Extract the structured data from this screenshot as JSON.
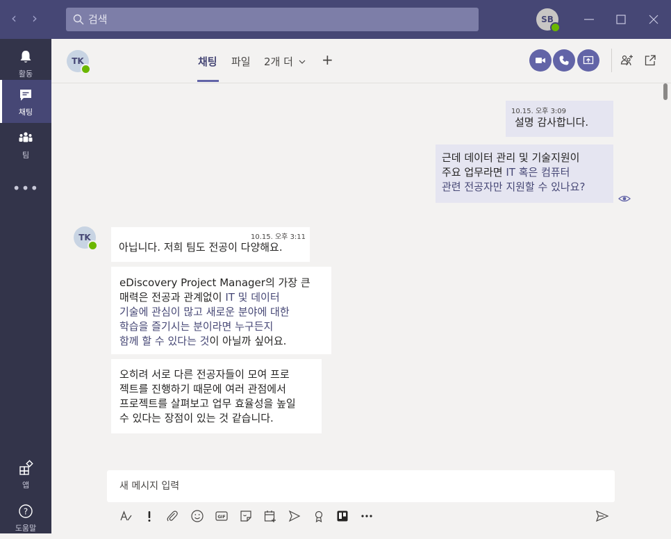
{
  "titlebar": {
    "search_placeholder": "검색",
    "user_initials": "SB"
  },
  "rail": {
    "items": [
      {
        "label": "활동",
        "icon": "bell-icon"
      },
      {
        "label": "채팅",
        "icon": "chat-icon"
      },
      {
        "label": "팀",
        "icon": "teams-icon"
      },
      {
        "label": "앱",
        "icon": "apps-icon"
      },
      {
        "label": "도움말",
        "icon": "help-icon"
      }
    ],
    "more": "•••"
  },
  "header": {
    "contact_initials": "TK",
    "tabs": [
      {
        "label": "채팅"
      },
      {
        "label": "파일"
      },
      {
        "label": "2개 더"
      }
    ],
    "add_tab": "+"
  },
  "messages": {
    "mine": [
      {
        "time": "10.15. 오후 3:09",
        "text": "설명 감사합니다."
      },
      {
        "lines": [
          {
            "plain": "근데 데이터 관리 및 기술지원이"
          },
          {
            "plain": "주요 업무라면 ",
            "hl": "IT 혹은 컴퓨터"
          },
          {
            "hl": "관련 전공자만 지원할 수 있나요?"
          }
        ]
      }
    ],
    "other": [
      {
        "initials": "TK",
        "time": "10.15. 오후 3:11",
        "text": "아닙니다. 저희 팀도 전공이 다양해요."
      },
      {
        "lines": [
          {
            "plain": "eDiscovery Project Manager의 가장 큰"
          },
          {
            "plain": "매력은 전공과 관계없이 ",
            "hl": "IT 및 데이터"
          },
          {
            "hl": "기술에 관심이 많고 새로운 분야에 대한"
          },
          {
            "hl": "학습을 즐기시는 분이라면 누구든지"
          },
          {
            "hl": "함께 할 수 있다는 것",
            "plain_after": "이 아닐까 싶어요."
          }
        ]
      },
      {
        "lines": [
          {
            "plain": "오히려 서로 다른 전공자들이 모여 프로"
          },
          {
            "plain": "젝트를 진행하기 때문에 여러 관점에서"
          },
          {
            "plain": "프로젝트를 살펴보고 업무 효율성을 높일"
          },
          {
            "plain": "수 있다는 장점이 있는 것 같습니다."
          }
        ]
      }
    ]
  },
  "compose": {
    "placeholder": "새 메시지 입력"
  },
  "colors": {
    "titlebar": "#464775",
    "rail": "#33344a",
    "accent": "#6264a7",
    "highlight_text": "#464775",
    "bubble_mine": "#e5e5f1",
    "presence": "#6bb700"
  }
}
